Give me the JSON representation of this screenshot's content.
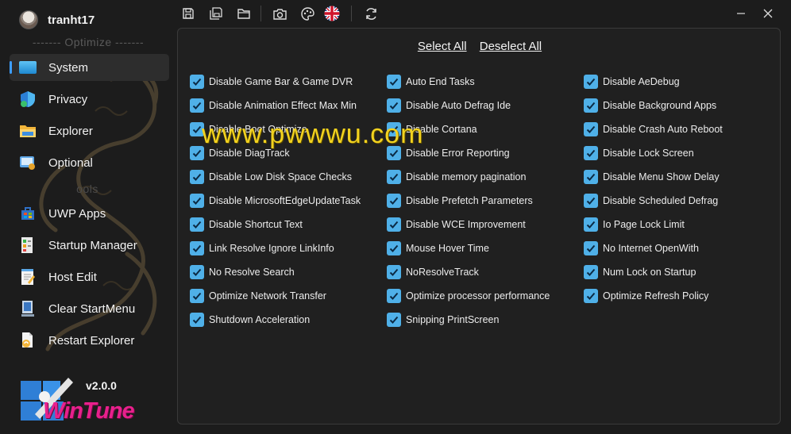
{
  "user": {
    "name": "tranht17"
  },
  "sidebar": {
    "optimize_header": "------- Optimize -------",
    "tools_header": "ools",
    "items": [
      {
        "label": "System",
        "icon": "monitor-icon",
        "active": true
      },
      {
        "label": "Privacy",
        "icon": "shield-icon"
      },
      {
        "label": "Explorer",
        "icon": "folder-icon"
      },
      {
        "label": "Optional",
        "icon": "optional-features-icon"
      },
      {
        "label": "UWP Apps",
        "icon": "store-icon"
      },
      {
        "label": "Startup Manager",
        "icon": "startup-icon"
      },
      {
        "label": "Host Edit",
        "icon": "notepad-icon"
      },
      {
        "label": "Clear StartMenu",
        "icon": "computer-icon"
      },
      {
        "label": "Restart Explorer",
        "icon": "restart-explorer-icon"
      }
    ],
    "version": "v2.0.0",
    "logo_text": "WinTune"
  },
  "toolbar": {
    "buttons": [
      "save-icon",
      "save-all-icon",
      "open-folder-icon",
      "camera-icon",
      "palette-icon",
      "uk-flag-icon",
      "refresh-icon"
    ],
    "window": [
      "minimize-icon",
      "close-icon"
    ]
  },
  "main": {
    "select_all": "Select All",
    "deselect_all": "Deselect All",
    "watermark": "www.pwwwu.com",
    "columns": [
      [
        "Disable Game Bar & Game DVR",
        "Disable Animation Effect Max Min",
        "Disable Boot Optimize",
        "Disable DiagTrack",
        "Disable Low Disk Space Checks",
        "Disable MicrosoftEdgeUpdateTask",
        "Disable Shortcut Text",
        "Link Resolve Ignore LinkInfo",
        "No Resolve Search",
        "Optimize Network Transfer",
        "Shutdown Acceleration"
      ],
      [
        "Auto End Tasks",
        "Disable Auto Defrag Ide",
        "Disable Cortana",
        "Disable Error Reporting",
        "Disable memory pagination",
        "Disable Prefetch Parameters",
        "Disable WCE Improvement",
        "Mouse Hover Time",
        "NoResolveTrack",
        "Optimize processor performance",
        "Snipping PrintScreen"
      ],
      [
        "Disable AeDebug",
        "Disable Background Apps",
        "Disable Crash Auto Reboot",
        "Disable Lock Screen",
        "Disable Menu Show Delay",
        "Disable Scheduled Defrag",
        "Io Page Lock Limit",
        "No Internet OpenWith",
        "Num Lock on Startup",
        "Optimize Refresh Policy"
      ]
    ]
  },
  "colors": {
    "accent": "#3d9eff",
    "checkbox": "#4fb0e8",
    "logo": "#e8208c",
    "watermark": "#f2d21f"
  }
}
